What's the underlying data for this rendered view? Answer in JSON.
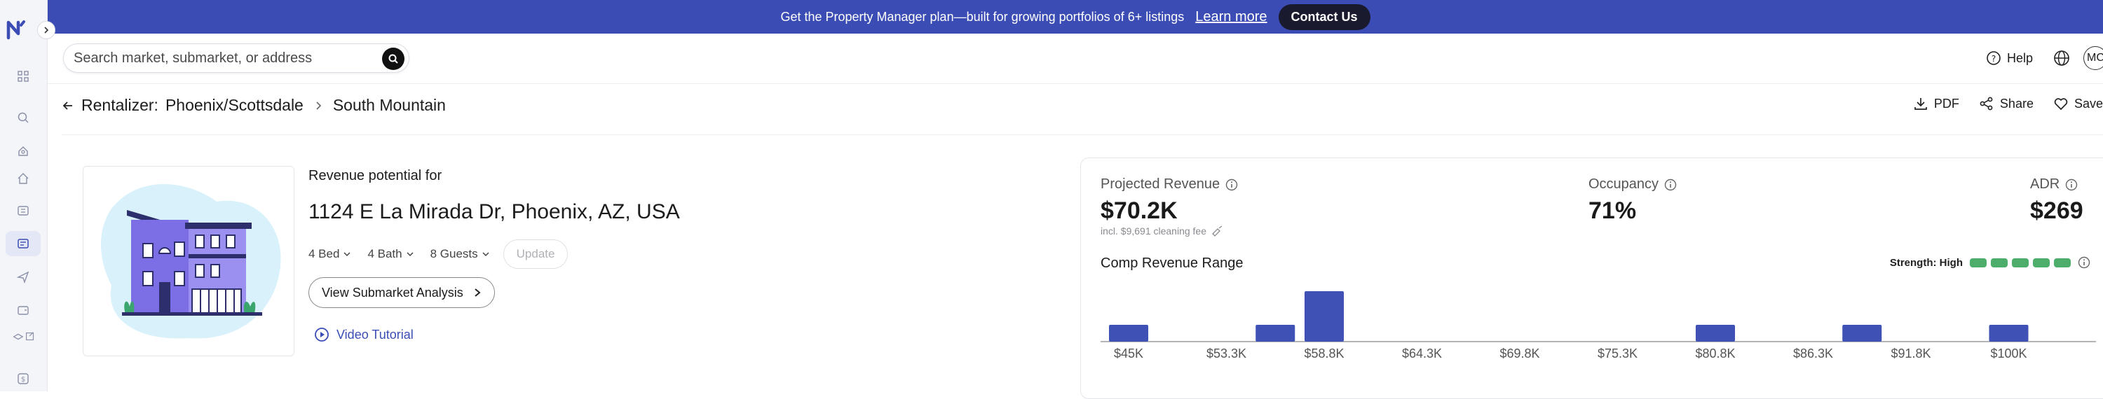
{
  "banner": {
    "text": "Get the Property Manager plan—built for growing portfolios of 6+ listings",
    "learn_more": "Learn more",
    "contact": "Contact Us"
  },
  "search": {
    "placeholder": "Search market, submarket, or address"
  },
  "top_right": {
    "help": "Help",
    "avatar_initials": "MC"
  },
  "breadcrumb": {
    "root": "Rentalizer:",
    "market": "Phoenix/Scottsdale",
    "submarket": "South Mountain"
  },
  "actions": {
    "pdf": "PDF",
    "share": "Share",
    "save": "Save"
  },
  "property": {
    "subtitle": "Revenue potential for",
    "address": "1124 E La Mirada Dr, Phoenix, AZ, USA",
    "beds": "4 Bed",
    "baths": "4 Bath",
    "guests": "8 Guests",
    "update": "Update",
    "view_submarket": "View Submarket Analysis",
    "video_tutorial": "Video Tutorial"
  },
  "metrics": {
    "projected_revenue_label": "Projected Revenue",
    "projected_revenue": "$70.2K",
    "cleaning_fee": "incl. $9,691 cleaning fee",
    "occupancy_label": "Occupancy",
    "occupancy": "71%",
    "adr_label": "ADR",
    "adr": "$269"
  },
  "comp": {
    "title": "Comp Revenue Range",
    "strength_label": "Strength: High",
    "strength_level": 1.0
  },
  "colors": {
    "accent": "#3b4db5",
    "bar": "#3f51b5",
    "strength": "#4cae6a"
  },
  "chart_data": {
    "type": "bar",
    "categories": [
      "$45K",
      "$53.3K",
      "$58.8K",
      "$64.3K",
      "$69.8K",
      "$75.3K",
      "$80.8K",
      "$86.3K",
      "$91.8K",
      "$100K"
    ],
    "bins": [
      {
        "position": 0,
        "count": 1
      },
      {
        "position": 1.5,
        "count": 1
      },
      {
        "position": 2,
        "count": 3
      },
      {
        "position": 6,
        "count": 1
      },
      {
        "position": 7.5,
        "count": 1
      },
      {
        "position": 9,
        "count": 1
      }
    ],
    "title": "Comp Revenue Range",
    "xlabel": "",
    "ylabel": ""
  }
}
